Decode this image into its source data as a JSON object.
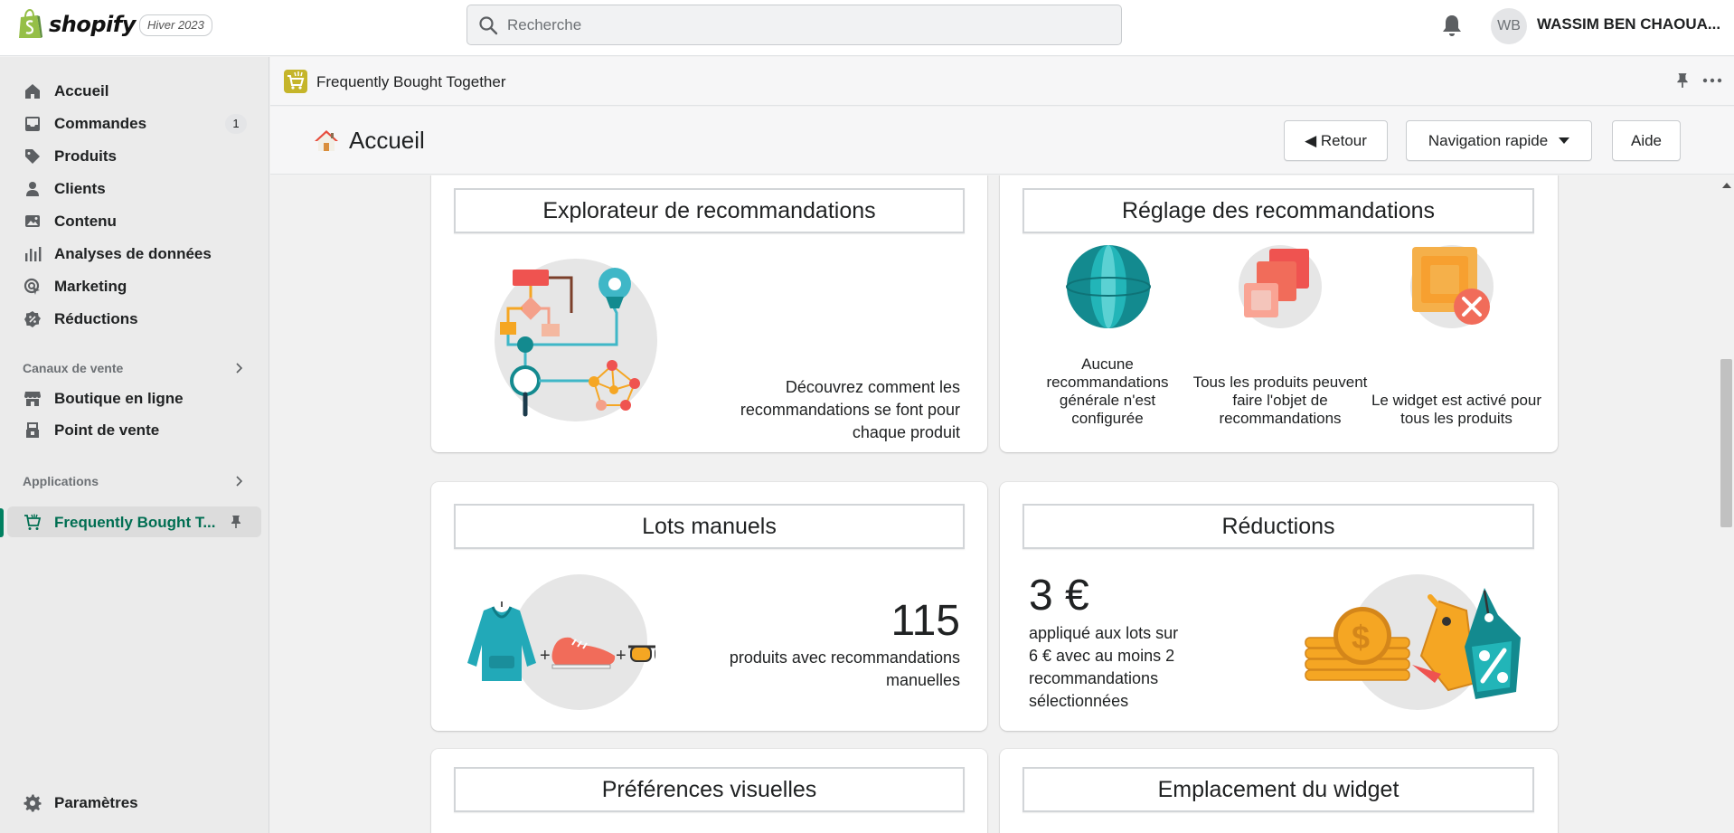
{
  "topbar": {
    "brand": "shopify",
    "edition": "Hiver 2023",
    "search_placeholder": "Recherche",
    "avatar_initials": "WB",
    "username": "WASSIM BEN CHAOUA..."
  },
  "sidebar": {
    "items": [
      {
        "label": "Accueil",
        "icon": "home-icon"
      },
      {
        "label": "Commandes",
        "icon": "orders-icon",
        "badge": "1"
      },
      {
        "label": "Produits",
        "icon": "tag-icon"
      },
      {
        "label": "Clients",
        "icon": "person-icon"
      },
      {
        "label": "Contenu",
        "icon": "image-icon"
      },
      {
        "label": "Analyses de données",
        "icon": "analytics-icon"
      },
      {
        "label": "Marketing",
        "icon": "marketing-icon"
      },
      {
        "label": "Réductions",
        "icon": "discount-icon"
      }
    ],
    "sales_channels_heading": "Canaux de vente",
    "sales_channels": [
      {
        "label": "Boutique en ligne",
        "icon": "store-icon"
      },
      {
        "label": "Point de vente",
        "icon": "pos-icon"
      }
    ],
    "apps_heading": "Applications",
    "apps": [
      {
        "label": "Frequently Bought T...",
        "icon": "cart-icon"
      }
    ],
    "settings_label": "Paramètres"
  },
  "app_strip": {
    "name": "Frequently Bought Together"
  },
  "page_header": {
    "title": "Accueil",
    "back_label": "◀ Retour",
    "nav_label": "Navigation rapide",
    "help_label": "Aide"
  },
  "cards": {
    "explorer": {
      "title": "Explorateur de recommandations",
      "text": "Découvrez comment les recommandations se font pour chaque produit"
    },
    "settings": {
      "title": "Réglage des recommandations",
      "col1": "Aucune recommandations générale n'est configurée",
      "col2": "Tous les produits peuvent faire l'objet de recommandations",
      "col3": "Le widget est activé pour tous les produits"
    },
    "manual": {
      "title": "Lots manuels",
      "number": "115",
      "text": "produits avec recommandations manuelles"
    },
    "discounts": {
      "title": "Réductions",
      "number": "3 €",
      "text": "appliqué aux lots sur 6 € avec au moins 2 recommandations sélectionnées"
    },
    "visual": {
      "title": "Préférences visuelles"
    },
    "placement": {
      "title": "Emplacement du widget"
    }
  },
  "colors": {
    "brand_green": "#95bf47",
    "active_green": "#008060",
    "teal": "#1aa5a8",
    "coral": "#f16c5a",
    "orange": "#f5a623"
  }
}
